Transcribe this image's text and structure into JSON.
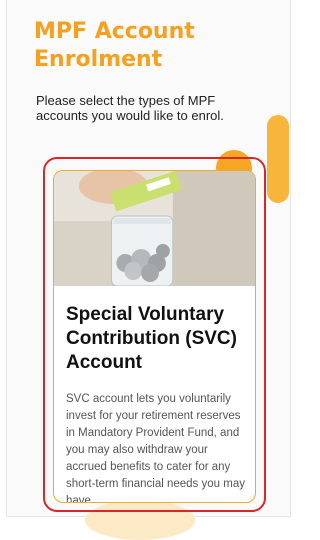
{
  "page": {
    "title": "MPF Account Enrolment",
    "intro": "Please select the types of MPF accounts you would like to enrol."
  },
  "card": {
    "title": "Special Voluntary Contribution (SVC) Account",
    "description": "SVC account lets you voluntarily invest for your retirement reserves in Mandatory Provident Fund, and you may also withdraw your accrued benefits to cater for any short-term financial needs you may have."
  },
  "colors": {
    "accent": "#f5a020",
    "focus_ring": "#d8262b",
    "card_border": "#f0a830"
  }
}
